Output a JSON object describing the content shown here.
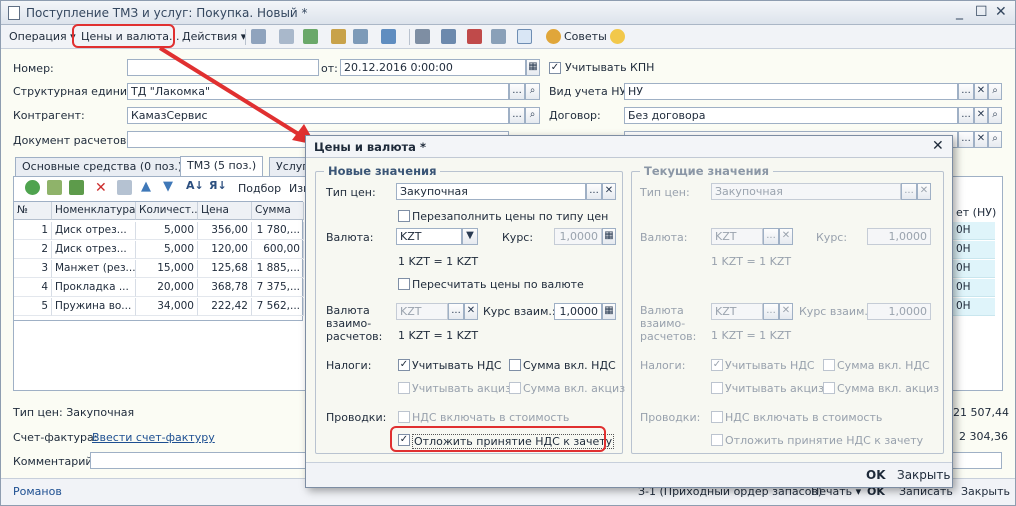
{
  "window": {
    "title": "Поступление ТМЗ и услуг: Покупка. Новый *",
    "min": "_",
    "max": "☐",
    "close": "✕"
  },
  "menu": {
    "operation": "Операция ▾",
    "prices": "Цены и валюта...",
    "actions": "Действия ▾",
    "tips": "Советы"
  },
  "form": {
    "number_label": "Номер:",
    "number_value": "",
    "from_label": "от:",
    "date_value": "20.12.2016  0:00:00",
    "kpn_label": "Учитывать КПН",
    "unit_label": "Структурная единица:",
    "unit_value": "ТД \"Лакомка\"",
    "nu_label": "Вид учета НУ:",
    "nu_value": "НУ",
    "contractor_label": "Контрагент:",
    "contractor_value": "КамазСервис",
    "contract_label": "Договор:",
    "contract_value": "Без договора",
    "doc_label": "Документ расчетов:"
  },
  "tabs": [
    {
      "label": "Основные средства (0 поз.)"
    },
    {
      "label": "ТМЗ (5 поз.)"
    },
    {
      "label": "Услуг"
    }
  ],
  "grid_toolbar": {
    "pick": "Подбор",
    "change": "Изм"
  },
  "grid": {
    "headers": [
      "№",
      "Номенклатура",
      "Количест...",
      "Цена",
      "Сумма"
    ],
    "rows": [
      {
        "n": "1",
        "name": "Диск отрез...",
        "qty": "5,000",
        "price": "356,00",
        "sum": "1 780,..."
      },
      {
        "n": "2",
        "name": "Диск отрез...",
        "qty": "5,000",
        "price": "120,00",
        "sum": "600,00"
      },
      {
        "n": "3",
        "name": "Манжет (рез...",
        "qty": "15,000",
        "price": "125,68",
        "sum": "1 885,..."
      },
      {
        "n": "4",
        "name": "Прокладка ...",
        "qty": "20,000",
        "price": "368,78",
        "sum": "7 375,..."
      },
      {
        "n": "5",
        "name": "Пружина во...",
        "qty": "34,000",
        "price": "222,42",
        "sum": "7 562,..."
      }
    ],
    "right_header": "ет (НУ)",
    "right_cells": [
      "0Н",
      "0Н",
      "0Н",
      "0Н",
      "0Н"
    ]
  },
  "footer": {
    "price_type": "Тип цен: Закупочная",
    "invoice_label": "Счет-фактура:",
    "invoice_link": "Ввести счет-фактуру",
    "comment_label": "Комментарий:",
    "total1": "21 507,44",
    "total2": "2 304,36",
    "user": "Романов",
    "order": "З-1 (Приходный ордер запасов)",
    "print": "Печать ▾",
    "ok": "OK",
    "save": "Записать",
    "close": "Закрыть"
  },
  "dialog": {
    "title": "Цены и валюта *",
    "new_group": "Новые значения",
    "current_group": "Текущие значения",
    "price_type_label": "Тип цен:",
    "price_type_value": "Закупочная",
    "refill_label": "Перезаполнить цены по типу цен",
    "currency_label": "Валюта:",
    "currency_value": "KZT",
    "rate_label": "Курс:",
    "rate_value": "1,0000",
    "rate_text": "1 KZT = 1 KZT",
    "recalc_label": "Пересчитать цены по валюте",
    "settle_currency_label": "Валюта взаимо-расчетов:",
    "settle_currency_value": "KZT",
    "settle_rate_label": "Курс взаим.:",
    "settle_rate_value": "1,0000",
    "taxes_label": "Налоги:",
    "vat_label": "Учитывать НДС",
    "sum_vat_label": "Сумма вкл. НДС",
    "excise_label": "Учитывать акциз",
    "sum_excise_label": "Сумма вкл. акциз",
    "posting_label": "Проводки:",
    "vat_cost_label": "НДС включать в стоимость",
    "defer_label": "Отложить принятие НДС к зачету",
    "ok": "OK",
    "save": "Закрыть"
  }
}
